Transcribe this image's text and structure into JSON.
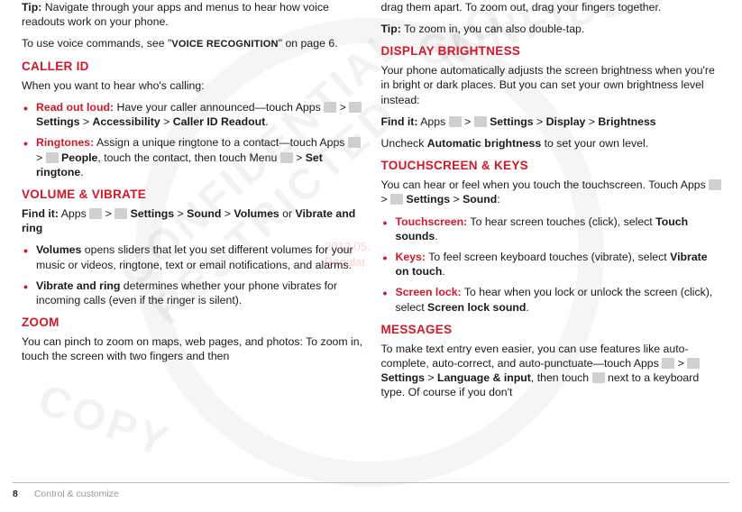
{
  "watermark": {
    "stamp_line1": "2012.05.",
    "stamp_line2": "Regulat",
    "seal1": "COPY",
    "seal2": "CONFIDENTIAL",
    "seal3": "CONFIDENTIAL RESTRICTED :: MO"
  },
  "left": {
    "tip_label": "Tip:",
    "tip_text": " Navigate through your apps and menus to hear how voice readouts work on your phone.",
    "voice_prefix": "To use voice commands, see \"",
    "voice_link": "VOICE RECOGNITION",
    "voice_suffix": "\" on page 6.",
    "caller_id_heading": "CALLER ID",
    "caller_id_intro": "When you want to hear who's calling:",
    "caller_items": [
      {
        "label": "Read out loud:",
        "text": " Have your caller announced—touch Apps ",
        "path": [
          "Settings",
          "Accessibility",
          "Caller ID Readout"
        ],
        "suffix": "."
      },
      {
        "label": "Ringtones:",
        "text": " Assign a unique ringtone to a contact—touch Apps ",
        "path": [
          "People"
        ],
        "mid": ", touch the contact, then touch Menu ",
        "path2": [
          "Set ringtone"
        ],
        "suffix": "."
      }
    ],
    "volume_heading": "VOLUME & VIBRATE",
    "findit_label": "Find it:",
    "findit_prefix": " Apps ",
    "findit_path": [
      "Settings",
      "Sound",
      "Volumes"
    ],
    "findit_or": " or ",
    "findit_alt": "Vibrate and ring",
    "volume_items": [
      {
        "label": "Volumes",
        "text": " opens sliders that let you set different volumes for your music or videos, ringtone, text or email notifications, and alarms."
      },
      {
        "label": "Vibrate and ring",
        "text": " determines whether your phone vibrates for incoming calls (even if the ringer is silent)."
      }
    ],
    "zoom_heading": "ZOOM",
    "zoom_text": "You can pinch to zoom on maps, web pages, and photos: To zoom in, touch the screen with two fingers and then"
  },
  "right": {
    "continuation": "drag them apart. To zoom out, drag your fingers together.",
    "tip_label": "Tip:",
    "tip_text": " To zoom in, you can also double-tap.",
    "brightness_heading": "DISPLAY BRIGHTNESS",
    "brightness_text": "Your phone automatically adjusts the screen brightness when you're in bright or dark places. But you can set your own brightness level instead:",
    "findit_label": "Find it:",
    "findit_prefix": " Apps ",
    "findit_path": [
      "Settings",
      "Display",
      "Brightness"
    ],
    "uncheck_prefix": "Uncheck ",
    "uncheck_bold": "Automatic brightness",
    "uncheck_suffix": " to set your own level.",
    "touchscreen_heading": "TOUCHSCREEN & KEYS",
    "touchscreen_intro": "You can hear or feel when you touch the touchscreen. Touch Apps ",
    "touchscreen_path": [
      "Settings",
      "Sound"
    ],
    "touchscreen_colon": ":",
    "touchscreen_items": [
      {
        "label": "Touchscreen:",
        "text": " To hear screen touches (click), select ",
        "bold": "Touch sounds",
        "suffix": "."
      },
      {
        "label": "Keys:",
        "text": " To feel screen keyboard touches (vibrate), select ",
        "bold": "Vibrate on touch",
        "suffix": "."
      },
      {
        "label": "Screen lock:",
        "text": " To hear when you lock or unlock the screen (click), select ",
        "bold": "Screen lock sound",
        "suffix": "."
      }
    ],
    "messages_heading": "MESSAGES",
    "messages_text1": "To make text entry even easier, you can use features like auto-complete, auto-correct, and auto-punctuate—touch Apps ",
    "messages_path": [
      "Settings",
      "Language & input"
    ],
    "messages_then": ", then touch ",
    "messages_text2": " next to a keyboard type. Of course if you don't"
  },
  "footer": {
    "page_number": "8",
    "section": "Control & customize"
  }
}
